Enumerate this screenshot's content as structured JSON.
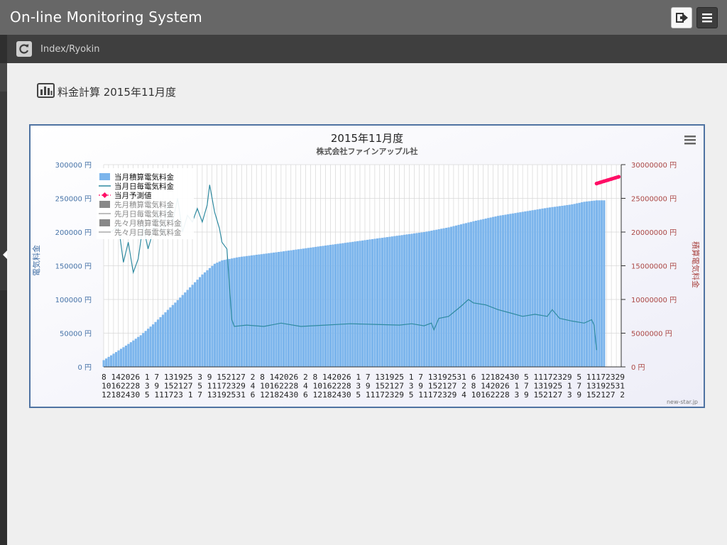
{
  "app": {
    "title": "On-line Monitoring System"
  },
  "breadcrumb": {
    "text": "Index/Ryokin"
  },
  "page": {
    "title": "料金計算 2015年11月度",
    "icon": "bar-chart-icon"
  },
  "header": {
    "logout_icon": "logout-icon",
    "menu_icon": "hamburger-menu-icon",
    "refresh_icon": "refresh-icon"
  },
  "chart_data": {
    "type": "area",
    "title": "2015年11月度",
    "subtitle": "株式会社ファインアップル社",
    "credit": "new-star.jp",
    "ylabel_left": "電気料金",
    "ylabel_right": "積算電気料金",
    "y_left": {
      "min": 0,
      "max": 300000,
      "ticks": [
        0,
        50000,
        100000,
        150000,
        200000,
        250000,
        300000
      ],
      "tick_labels": [
        "0 円",
        "50000 円",
        "100000 円",
        "150000 円",
        "200000 円",
        "250000 円",
        "300000 円"
      ]
    },
    "y_right": {
      "min": 0,
      "max": 30000000,
      "ticks": [
        0,
        5000000,
        10000000,
        15000000,
        20000000,
        25000000,
        30000000
      ],
      "tick_labels": [
        "0 円",
        "5000000 円",
        "10000000 円",
        "15000000 円",
        "20000000 円",
        "25000000 円",
        "30000000 円"
      ]
    },
    "legend": [
      {
        "name": "当月積算電気料金",
        "color": "#7cb5ec",
        "kind": "area",
        "active": true
      },
      {
        "name": "当月日毎電気料金",
        "color": "#2f8aa0",
        "kind": "line",
        "active": true
      },
      {
        "name": "当月予測値",
        "color": "#ff0f66",
        "kind": "marker",
        "active": true
      },
      {
        "name": "先月積算電気料金",
        "color": "#888888",
        "kind": "area",
        "active": false
      },
      {
        "name": "先月日毎電気料金",
        "color": "#aaaaaa",
        "kind": "line",
        "active": false
      },
      {
        "name": "先々月積算電気料金",
        "color": "#888888",
        "kind": "area",
        "active": false
      },
      {
        "name": "先々月日毎電気料金",
        "color": "#aaaaaa",
        "kind": "line",
        "active": false
      }
    ],
    "x_label_rows": [
      "8  142026  1   7  131925  3   9  152127  2   8  142026  2   8  142026  1   7  131925  1   7  13192531  6  12182430  5  11172329  5  11172329",
      "10162228  3   9  152127  5  11172329  4  10162228  4  10162228  3   9  152127  3   9  152127  2   8  142026  1   7  131925  1   7  13192531",
      "12182430  5  111723  1   7  13192531  6  12182430  6  12182430  5  11172329  5  11172329  4  10162228  3   9  152127  3   9  152127  2"
    ],
    "series": [
      {
        "name": "当月積算電気料金",
        "axis": "right",
        "type": "area",
        "points": [
          [
            0,
            1000000
          ],
          [
            5,
            2200000
          ],
          [
            10,
            3400000
          ],
          [
            15,
            4700000
          ],
          [
            20,
            6300000
          ],
          [
            25,
            8100000
          ],
          [
            30,
            9900000
          ],
          [
            35,
            11800000
          ],
          [
            40,
            13700000
          ],
          [
            45,
            15300000
          ],
          [
            48,
            15800000
          ],
          [
            55,
            16300000
          ],
          [
            70,
            17000000
          ],
          [
            90,
            18000000
          ],
          [
            110,
            19000000
          ],
          [
            130,
            20000000
          ],
          [
            140,
            20700000
          ],
          [
            150,
            21600000
          ],
          [
            160,
            22400000
          ],
          [
            170,
            23000000
          ],
          [
            180,
            23600000
          ],
          [
            190,
            24100000
          ],
          [
            195,
            24500000
          ],
          [
            200,
            24700000
          ],
          [
            203,
            24700000
          ]
        ]
      },
      {
        "name": "当月日毎電気料金",
        "axis": "left",
        "type": "line",
        "points": [
          [
            3,
            200000
          ],
          [
            6,
            210000
          ],
          [
            8,
            155000
          ],
          [
            10,
            185000
          ],
          [
            12,
            140000
          ],
          [
            14,
            160000
          ],
          [
            16,
            210000
          ],
          [
            18,
            175000
          ],
          [
            20,
            200000
          ],
          [
            22,
            230000
          ],
          [
            24,
            195000
          ],
          [
            26,
            245000
          ],
          [
            28,
            215000
          ],
          [
            30,
            250000
          ],
          [
            32,
            200000
          ],
          [
            34,
            225000
          ],
          [
            36,
            215000
          ],
          [
            38,
            235000
          ],
          [
            40,
            215000
          ],
          [
            42,
            240000
          ],
          [
            43,
            270000
          ],
          [
            45,
            230000
          ],
          [
            47,
            205000
          ],
          [
            48,
            185000
          ],
          [
            50,
            175000
          ],
          [
            52,
            70000
          ],
          [
            53,
            60000
          ],
          [
            58,
            62000
          ],
          [
            65,
            60000
          ],
          [
            72,
            65000
          ],
          [
            80,
            60000
          ],
          [
            90,
            62000
          ],
          [
            100,
            64000
          ],
          [
            110,
            63000
          ],
          [
            120,
            62000
          ],
          [
            125,
            64000
          ],
          [
            130,
            61000
          ],
          [
            133,
            65000
          ],
          [
            134,
            55000
          ],
          [
            136,
            72000
          ],
          [
            140,
            75000
          ],
          [
            145,
            90000
          ],
          [
            148,
            100000
          ],
          [
            150,
            95000
          ],
          [
            155,
            92000
          ],
          [
            160,
            85000
          ],
          [
            165,
            80000
          ],
          [
            170,
            75000
          ],
          [
            175,
            78000
          ],
          [
            180,
            75000
          ],
          [
            182,
            85000
          ],
          [
            185,
            72000
          ],
          [
            190,
            68000
          ],
          [
            195,
            65000
          ],
          [
            198,
            70000
          ],
          [
            199,
            62000
          ],
          [
            200,
            25000
          ]
        ]
      },
      {
        "name": "当月予測値",
        "axis": "right",
        "type": "line",
        "points": [
          [
            200,
            27200000
          ],
          [
            209,
            28200000
          ]
        ]
      }
    ]
  }
}
